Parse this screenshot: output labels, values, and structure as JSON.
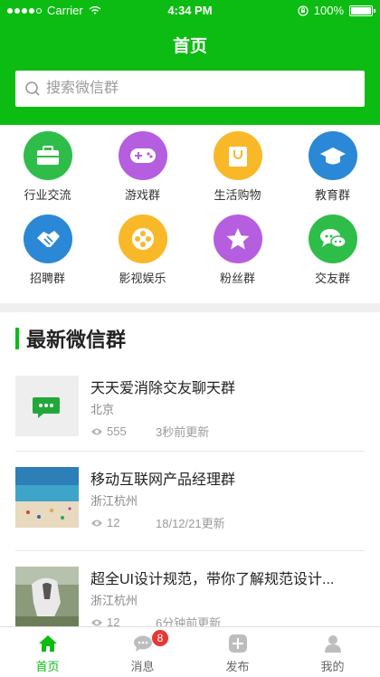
{
  "status_bar": {
    "carrier": "Carrier",
    "time": "4:34 PM",
    "battery": "100%"
  },
  "nav": {
    "title": "首页"
  },
  "search": {
    "placeholder": "搜索微信群"
  },
  "categories": [
    {
      "label": "行业交流",
      "icon": "briefcase-icon",
      "color": "#2fbd4a"
    },
    {
      "label": "游戏群",
      "icon": "gamepad-icon",
      "color": "#b55ee0"
    },
    {
      "label": "生活购物",
      "icon": "shopping-bag-icon",
      "color": "#f8b828"
    },
    {
      "label": "教育群",
      "icon": "graduation-cap-icon",
      "color": "#2a88d6"
    },
    {
      "label": "招聘群",
      "icon": "handshake-icon",
      "color": "#2a88d6"
    },
    {
      "label": "影视娱乐",
      "icon": "film-reel-icon",
      "color": "#f8b828"
    },
    {
      "label": "粉丝群",
      "icon": "star-icon",
      "color": "#b55ee0"
    },
    {
      "label": "交友群",
      "icon": "chat-bubbles-icon",
      "color": "#2fbd4a"
    }
  ],
  "section": {
    "title": "最新微信群"
  },
  "groups": [
    {
      "name": "天天爱消除交友聊天群",
      "location": "北京",
      "views": "555",
      "updated": "3秒前更新"
    },
    {
      "name": "移动互联网产品经理群",
      "location": "浙江杭州",
      "views": "12",
      "updated": "18/12/21更新"
    },
    {
      "name": "超全UI设计规范，带你了解规范设计...",
      "location": "浙江杭州",
      "views": "12",
      "updated": "6分钟前更新"
    }
  ],
  "tabs": [
    {
      "label": "首页",
      "icon": "home-icon"
    },
    {
      "label": "消息",
      "icon": "message-icon",
      "badge": "8"
    },
    {
      "label": "发布",
      "icon": "add-icon"
    },
    {
      "label": "我的",
      "icon": "user-icon"
    }
  ],
  "colors": {
    "brand_green": "#0cbc12",
    "badge_red": "#e53935"
  }
}
